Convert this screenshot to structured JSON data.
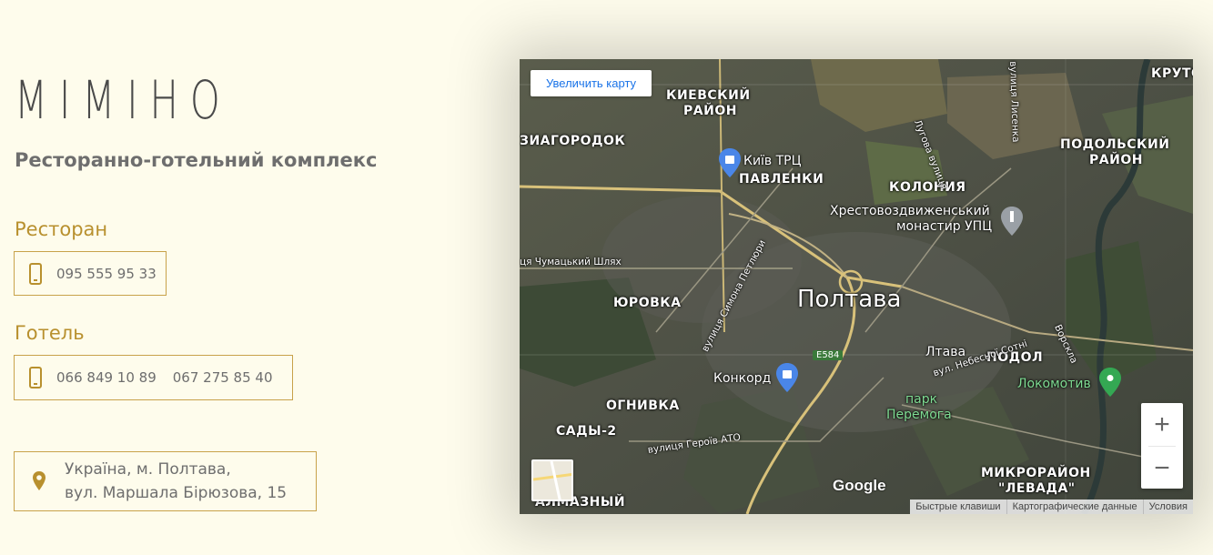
{
  "brand": {
    "logo_text": "MIMIHO"
  },
  "subtitle": "Ресторанно-готельний комплекс",
  "restaurant": {
    "title": "Ресторан",
    "phones": [
      "095 555 95 33"
    ]
  },
  "hotel": {
    "title": "Готель",
    "phones": [
      "066 849 10 89",
      "067 275 85 40"
    ]
  },
  "address": {
    "line1": "Україна, м. Полтава,",
    "line2": "вул. Маршала Бірюзова, 15"
  },
  "map": {
    "enlarge_label": "Увеличить карту",
    "labels": {
      "kievsky1": "КИЕВСКИЙ",
      "kievsky2": "РАЙОН",
      "kruto": "КРУТО",
      "podolsky1": "ПОДОЛЬСКИЙ",
      "podolsky2": "РАЙОН",
      "zvyagorodok": "ЗИАГОРОДОК",
      "kyiv_trc": "Київ ТРЦ",
      "pavlenki": "ПАВЛЕНКИ",
      "koloniya": "КОЛОНИЯ",
      "monastery1": "Хрестовоздвиженський",
      "monastery2": "монастир УПЦ",
      "chumatsky": "ця Чумацький Шлях",
      "lugova": "Лугова вулиця",
      "lysenka": "вулиця Лисенка",
      "yurovka": "ЮРОВКА",
      "petlyury": "вулиця Симона Петлюри",
      "poltava": "Полтава",
      "ltava": "Лтава",
      "podol": "ПОДОЛ",
      "vorskla": "Ворскла",
      "e584": "E584",
      "nebesnoi": "вул. Небесної Сотні",
      "lokomotiv": "Локомотив",
      "konkord": "Конкорд",
      "park1": "парк",
      "park2": "Перемога",
      "ognivka": "ОГНИВКА",
      "sady2": "САДЫ-2",
      "geroiv": "вулиця Героїв АТО",
      "levada1": "МИКРОРАЙОН",
      "levada2": "\"ЛЕВАДА\"",
      "almazny": "АЛМАЗНЫЙ"
    },
    "google": "Google",
    "attribution": [
      "Быстрые клавиши",
      "Картографические данные",
      "Условия"
    ],
    "zoom_in": "+",
    "zoom_out": "−"
  },
  "colors": {
    "background": "#fefcec",
    "accent": "#b8902e",
    "text": "#6e6e6e"
  }
}
